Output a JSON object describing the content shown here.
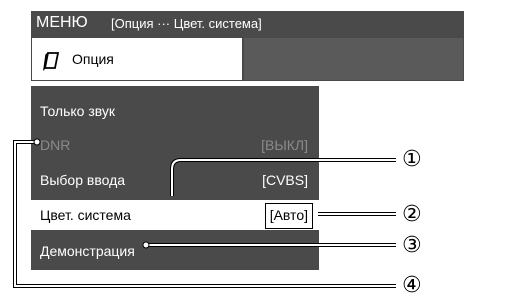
{
  "header": {
    "title": "МЕНЮ",
    "subtitle": "[Опция ··· Цвет. система]"
  },
  "tabs": {
    "option_label": "Опция",
    "option_icon": "notebook-icon"
  },
  "menu": {
    "items": [
      {
        "label": "Только звук",
        "value": ""
      },
      {
        "label": "DNR",
        "value": "[ВЫКЛ]",
        "disabled": true
      },
      {
        "label": "Выбор ввода",
        "value": "[CVBS]"
      },
      {
        "label": "Цвет. система",
        "value": "[Авто]",
        "selected": true
      },
      {
        "label": "Демонстрация",
        "value": ""
      }
    ]
  },
  "callouts": [
    "①",
    "②",
    "③",
    "④"
  ],
  "colors": {
    "panel": "#4a4a4a",
    "text_light": "#ffffff",
    "text_disabled": "#8a8a8a",
    "selected_bg": "#ffffff",
    "line": "#666666"
  }
}
